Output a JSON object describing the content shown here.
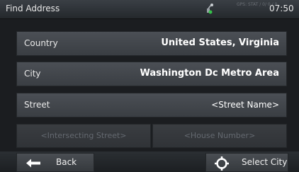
{
  "header": {
    "title": "Find Address",
    "gps_info": "GPS: STAT / 0/ 0 / 0",
    "clock": "07:50"
  },
  "rows": [
    {
      "label": "Country",
      "value": "United States, Virginia"
    },
    {
      "label": "City",
      "value": "Washington Dc Metro Area"
    },
    {
      "label": "Street",
      "value": "<Street Name>"
    }
  ],
  "secondary": {
    "intersecting": "<Intersecting Street>",
    "house_number": "<House Number>"
  },
  "footer": {
    "back_label": "Back",
    "select_label": "Select City"
  },
  "icons": {
    "gps": "satellite-icon",
    "back": "arrow-left-icon",
    "select": "crosshair-icon"
  }
}
